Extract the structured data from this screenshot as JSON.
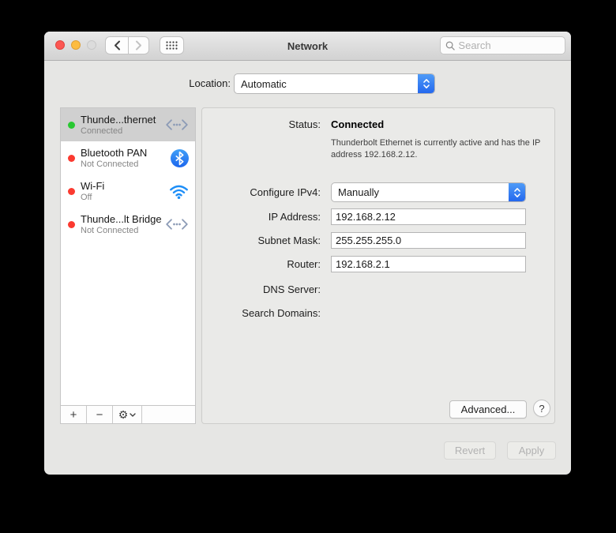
{
  "window": {
    "title": "Network",
    "search_placeholder": "Search"
  },
  "location": {
    "label": "Location:",
    "value": "Automatic"
  },
  "sidebar": {
    "items": [
      {
        "name": "Thunde...thernet",
        "status": "Connected",
        "dot_color": "green",
        "icon": "thunderbolt-ethernet-icon",
        "selected": true
      },
      {
        "name": "Bluetooth PAN",
        "status": "Not Connected",
        "dot_color": "red",
        "icon": "bluetooth-icon",
        "selected": false
      },
      {
        "name": "Wi-Fi",
        "status": "Off",
        "dot_color": "red",
        "icon": "wifi-icon",
        "selected": false
      },
      {
        "name": "Thunde...lt Bridge",
        "status": "Not Connected",
        "dot_color": "red",
        "icon": "thunderbolt-ethernet-icon",
        "selected": false
      }
    ],
    "toolbar": {
      "add": "+",
      "remove": "−",
      "action_menu_icon": "gear-icon"
    }
  },
  "main": {
    "status_label": "Status:",
    "status_value": "Connected",
    "status_description": "Thunderbolt Ethernet is currently active and has the IP address 192.168.2.12.",
    "configure_ipv4_label": "Configure IPv4:",
    "configure_ipv4_value": "Manually",
    "ip_address_label": "IP Address:",
    "ip_address_value": "192.168.2.12",
    "subnet_mask_label": "Subnet Mask:",
    "subnet_mask_value": "255.255.255.0",
    "router_label": "Router:",
    "router_value": "192.168.2.1",
    "dns_server_label": "DNS Server:",
    "search_domains_label": "Search Domains:",
    "advanced_button": "Advanced...",
    "help_button": "?"
  },
  "footer": {
    "revert_button": "Revert",
    "apply_button": "Apply"
  },
  "colors": {
    "accent_blue": "#2f78f2",
    "status_green": "#29c832",
    "status_red": "#fb3a30",
    "bluetooth_blue": "#2e7de9",
    "wifi_blue": "#1e8ef7",
    "ethernet_icon_gray_blue": "#8c9bb6"
  }
}
